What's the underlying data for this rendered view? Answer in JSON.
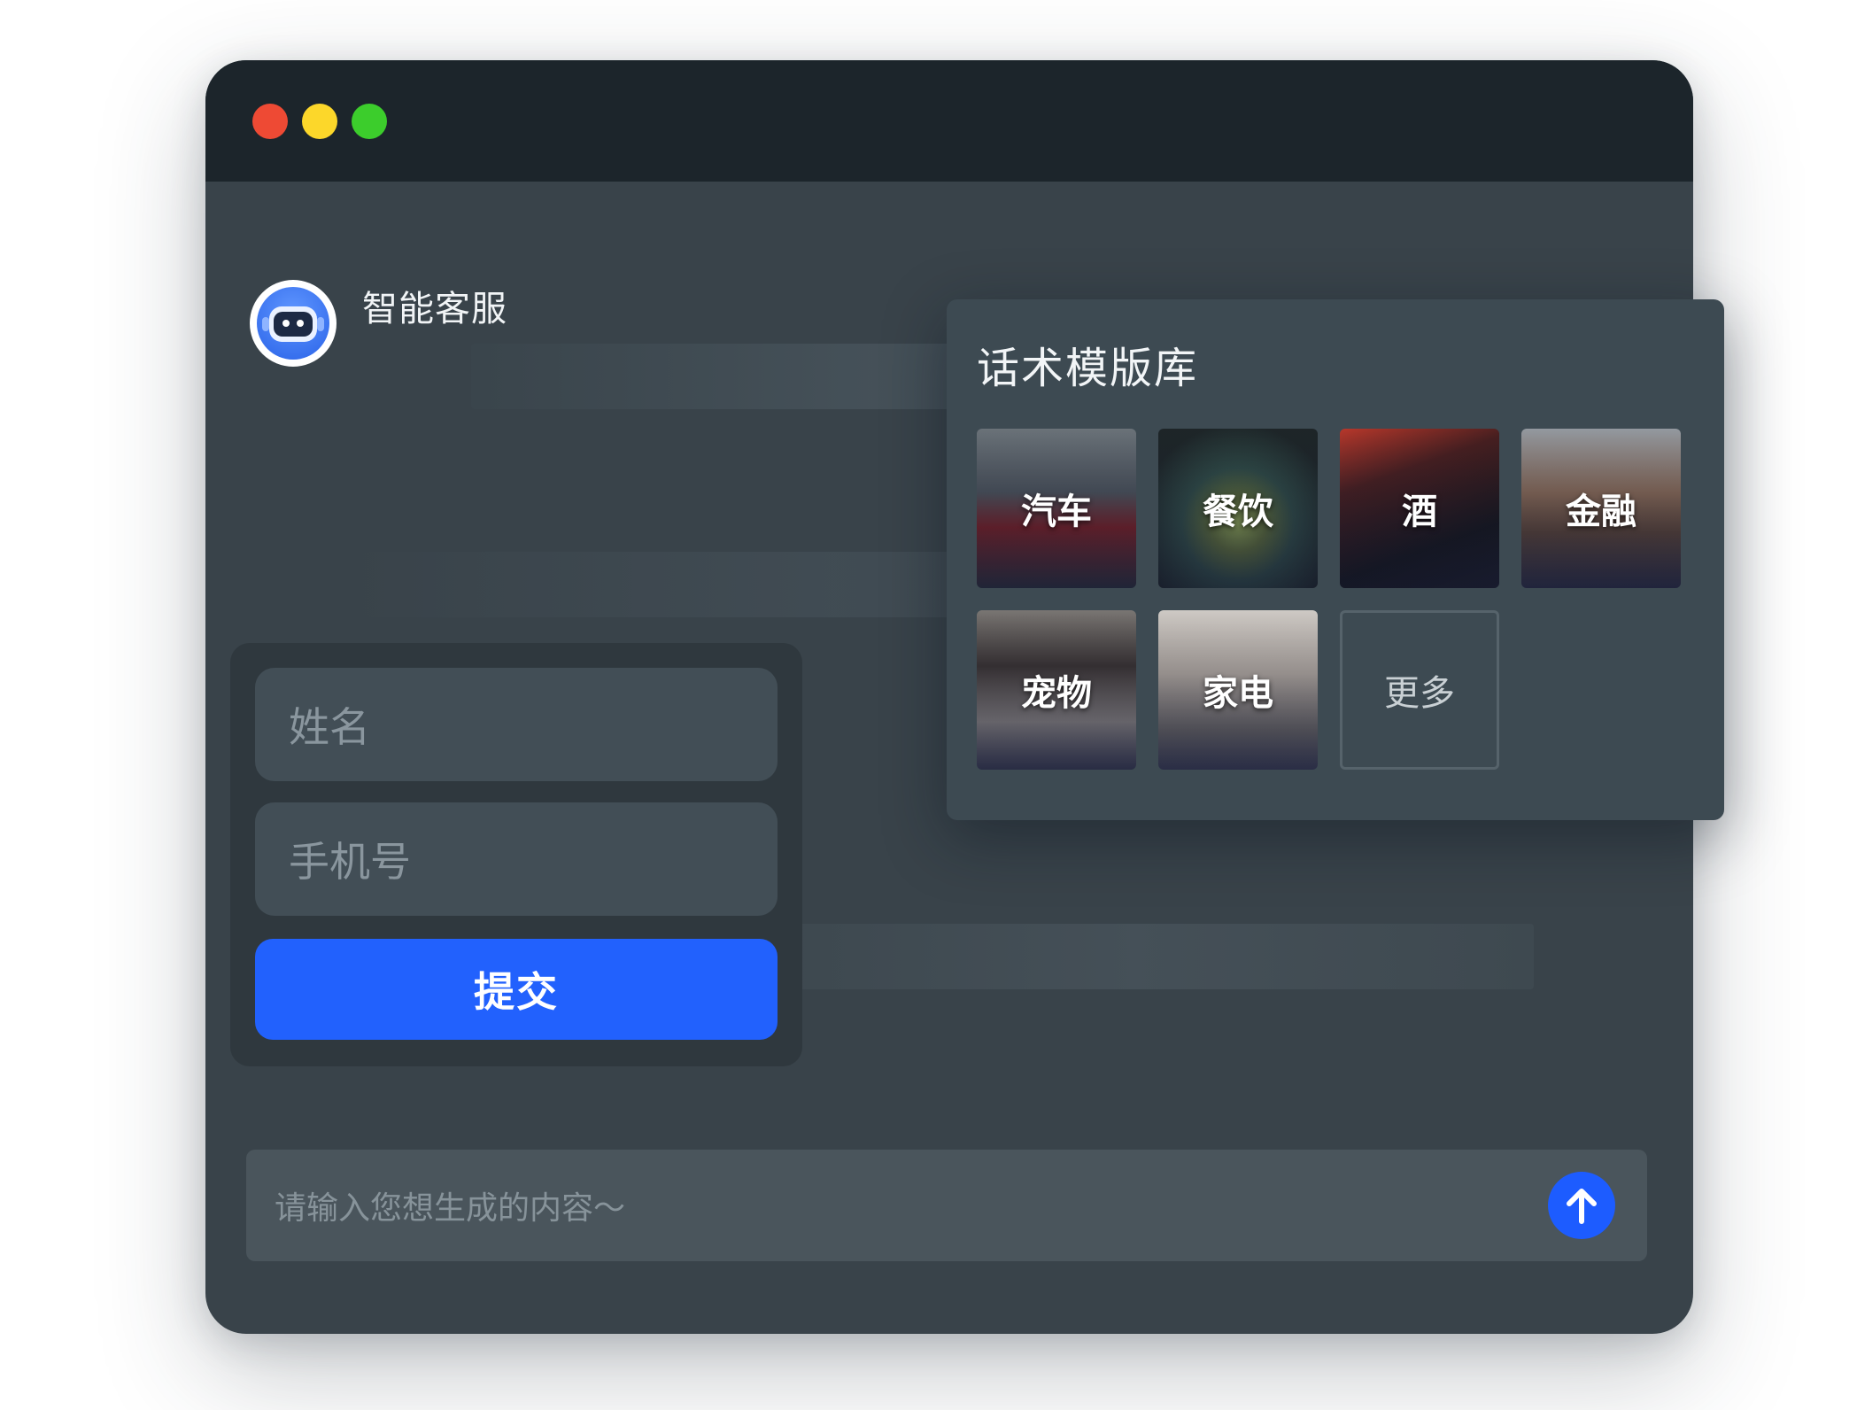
{
  "window": {
    "controls": [
      "close",
      "minimize",
      "maximize"
    ]
  },
  "bot": {
    "name": "智能客服",
    "avatar_icon": "robot-icon"
  },
  "form": {
    "name_placeholder": "姓名",
    "phone_placeholder": "手机号",
    "submit_label": "提交"
  },
  "templates": {
    "title": "话术模版库",
    "items": [
      {
        "label": "汽车"
      },
      {
        "label": "餐饮"
      },
      {
        "label": "酒"
      },
      {
        "label": "金融"
      },
      {
        "label": "宠物"
      },
      {
        "label": "家电"
      },
      {
        "label": "更多"
      }
    ]
  },
  "chat": {
    "input_placeholder": "请输入您想生成的内容～",
    "send_icon": "arrow-up-icon"
  },
  "colors": {
    "accent": "#2261fd",
    "window_bg": "#39434a",
    "titlebar_bg": "#1c252b",
    "close": "#ee4a34",
    "minimize": "#fcd72a",
    "maximize": "#3ccd2c"
  }
}
